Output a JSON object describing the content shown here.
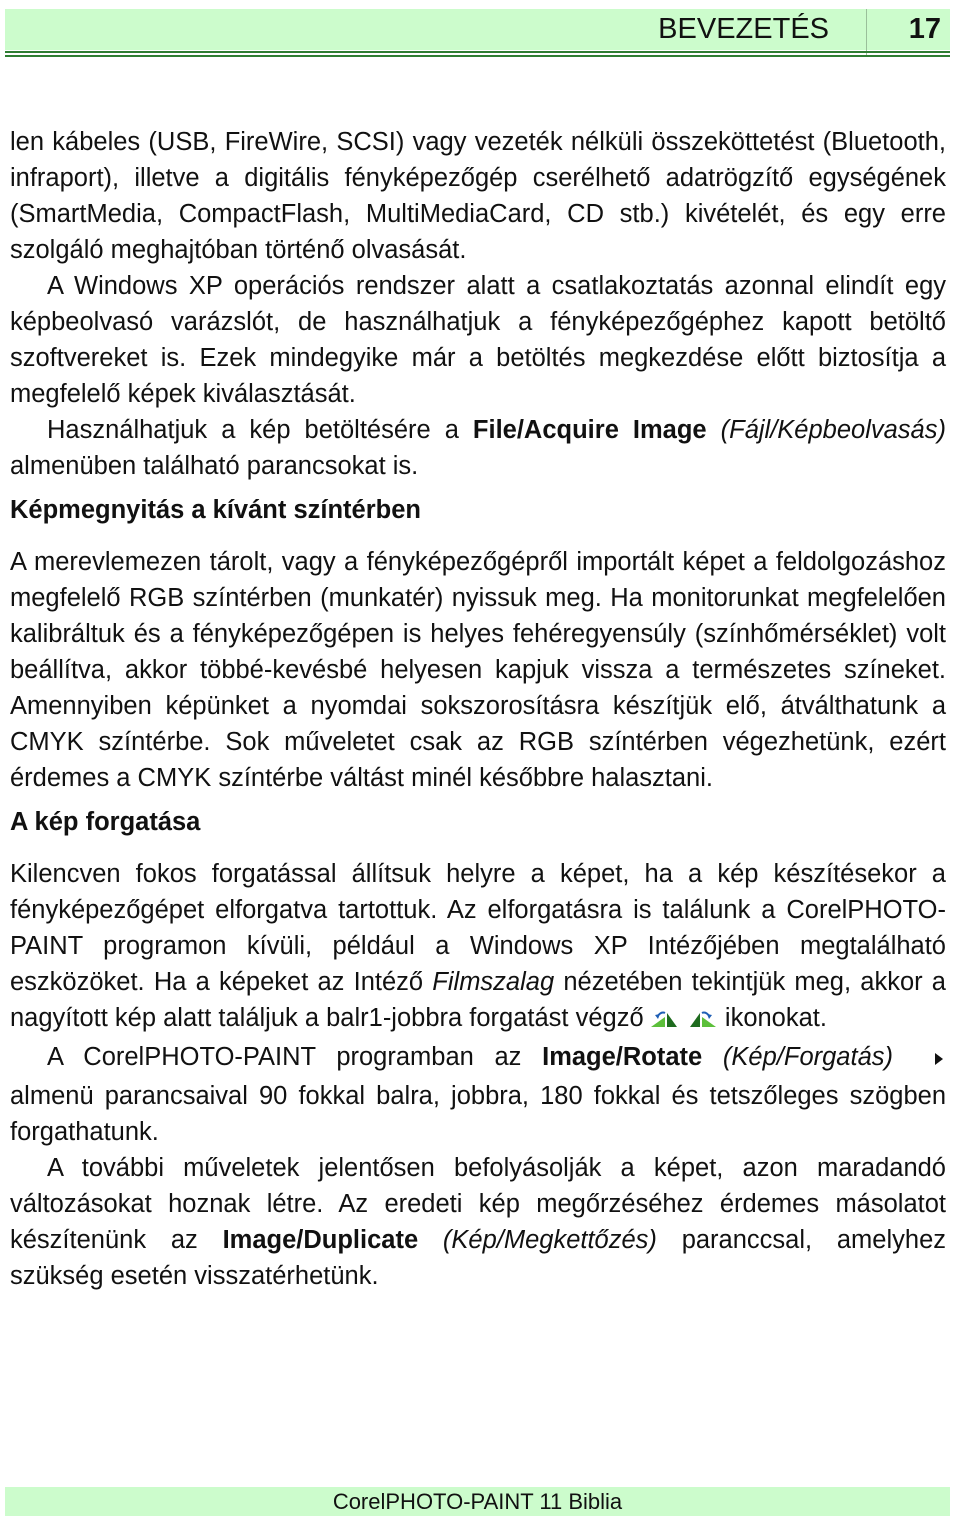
{
  "header": {
    "chapter_title": "BEVEZETÉS",
    "page_number": "17",
    "band_color": "#ccfccc",
    "rule_color": "#2e7d32"
  },
  "body": {
    "p1": "len kábeles (USB, FireWire, SCSI) vagy vezeték nélküli összeköttetést (Bluetooth, infraport), illetve a digitális fényképezőgép cserélhető adatrögzítő egységének (SmartMedia, CompactFlash, MultiMediaCard, CD stb.) kivételét, és egy erre szolgáló meghajtóban történő olvasását.",
    "p2": "A Windows XP operációs rendszer alatt a csatlakoztatás azonnal elindít egy képbeolvasó varázslót, de használhatjuk a fényképezőgéphez kapott betöltő szoftvereket is. Ezek mindegyike már a betöltés megkezdése előtt biztosítja a megfelelő képek kiválasztását.",
    "p3": {
      "pre": "Használhatjuk a kép betöltésére a ",
      "bold": "File/Acquire Image",
      "italic": "(Fájl/Képbeolvasás)",
      "post": " almenüben található parancsokat is."
    },
    "h1": "Képmegnyitás a kívánt színtérben",
    "p4": "A merevlemezen tárolt, vagy a fényképezőgépről importált képet a feldolgozáshoz megfelelő RGB színtérben (munkatér) nyissuk meg. Ha monitorunkat megfelelően kalibráltuk és a fényképezőgépen is helyes fehéregyensúly (színhőmérséklet) volt beállítva, akkor többé-kevésbé helyesen kapjuk vissza a természetes színeket. Amennyiben képünket a nyomdai sokszorosításra készítjük elő, átválthatunk a CMYK színtérbe. Sok műveletet csak az RGB színtérben végezhetünk, ezért érdemes a CMYK színtérbe váltást minél későbbre halasztani.",
    "h2": "A kép forgatása",
    "p5": {
      "pre": "Kilencven fokos forgatással állítsuk helyre a képet, ha a kép készítésekor a fényképezőgépet elforgatva tartottuk. Az elforgatásra is találunk a CorelPHOTO-PAINT programon kívüli, például a Windows XP Intézőjében megtalálható eszközöket. Ha a képeket az Intéző ",
      "italic": "Filmszalag",
      "mid": " nézetében tekintjük meg, akkor a nagyított kép alatt találjuk a balr1-jobbra forgatást végző ",
      "icons": [
        "rotate-left-icon",
        "rotate-right-icon"
      ],
      "post": " ikonokat."
    },
    "p6": {
      "pre": "A CorelPHOTO-PAINT programban az ",
      "bold": "Image/Rotate",
      "italic": "(Kép/Forgatás)",
      "submenu_icon": "submenu-arrow-icon",
      "post": " almenü parancsaival 90 fokkal balra, jobbra, 180 fokkal és tetszőleges szögben forgathatunk."
    },
    "p7": {
      "pre": "A további műveletek jelentősen befolyásolják a képet, azon maradandó változásokat hoznak létre. Az eredeti kép megőrzéséhez érdemes másolatot készítenünk az ",
      "bold": "Image/Duplicate",
      "italic": "(Kép/Megkettőzés)",
      "post": " paranccsal, amelyhez szükség esetén visszatérhetünk."
    }
  },
  "footer": {
    "book_title": "CorelPHOTO-PAINT 11 Biblia"
  }
}
